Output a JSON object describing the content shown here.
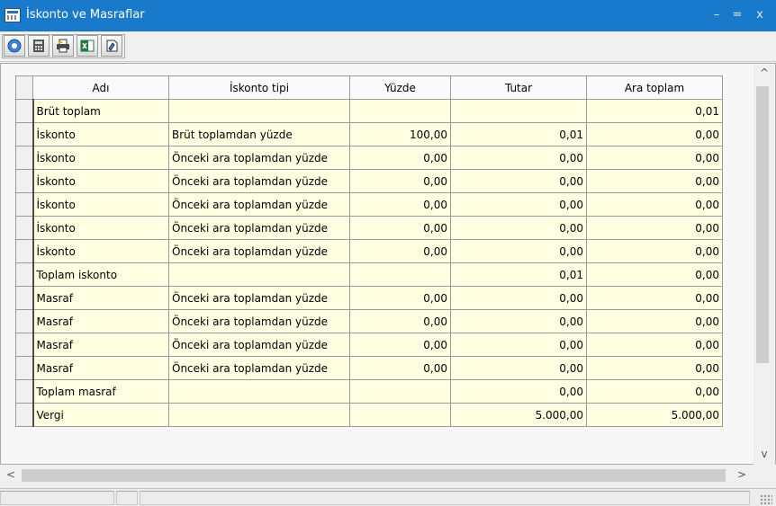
{
  "window": {
    "title": "İskonto ve Masraflar",
    "controls": {
      "minimize": "–",
      "maximize": "=",
      "close": "x"
    }
  },
  "toolbar": {
    "icons": [
      "help-icon",
      "calculator-icon",
      "print-icon",
      "excel-icon",
      "properties-icon"
    ]
  },
  "grid": {
    "columns": [
      "Adı",
      "İskonto tipi",
      "Yüzde",
      "Tutar",
      "Ara toplam"
    ],
    "rows": [
      {
        "name": "Brüt toplam",
        "type": "",
        "percent": "",
        "amount": "",
        "subtotal": "0,01"
      },
      {
        "name": "İskonto",
        "type": "Brüt toplamdan yüzde",
        "percent": "100,00",
        "amount": "0,01",
        "subtotal": "0,00"
      },
      {
        "name": "İskonto",
        "type": "Önceki ara toplamdan yüzde",
        "percent": "0,00",
        "amount": "0,00",
        "subtotal": "0,00"
      },
      {
        "name": "İskonto",
        "type": "Önceki ara toplamdan yüzde",
        "percent": "0,00",
        "amount": "0,00",
        "subtotal": "0,00"
      },
      {
        "name": "İskonto",
        "type": "Önceki ara toplamdan yüzde",
        "percent": "0,00",
        "amount": "0,00",
        "subtotal": "0,00"
      },
      {
        "name": "İskonto",
        "type": "Önceki ara toplamdan yüzde",
        "percent": "0,00",
        "amount": "0,00",
        "subtotal": "0,00"
      },
      {
        "name": "İskonto",
        "type": "Önceki ara toplamdan yüzde",
        "percent": "0,00",
        "amount": "0,00",
        "subtotal": "0,00"
      },
      {
        "name": "Toplam iskonto",
        "type": "",
        "percent": "",
        "amount": "0,01",
        "subtotal": "0,00"
      },
      {
        "name": "Masraf",
        "type": "Önceki ara toplamdan yüzde",
        "percent": "0,00",
        "amount": "0,00",
        "subtotal": "0,00"
      },
      {
        "name": "Masraf",
        "type": "Önceki ara toplamdan yüzde",
        "percent": "0,00",
        "amount": "0,00",
        "subtotal": "0,00"
      },
      {
        "name": "Masraf",
        "type": "Önceki ara toplamdan yüzde",
        "percent": "0,00",
        "amount": "0,00",
        "subtotal": "0,00"
      },
      {
        "name": "Masraf",
        "type": "Önceki ara toplamdan yüzde",
        "percent": "0,00",
        "amount": "0,00",
        "subtotal": "0,00"
      },
      {
        "name": "Toplam masraf",
        "type": "",
        "percent": "",
        "amount": "0,00",
        "subtotal": "0,00"
      },
      {
        "name": "Vergi",
        "type": "",
        "percent": "",
        "amount": "5.000,00",
        "subtotal": "5.000,00"
      }
    ]
  },
  "scrollbars": {
    "up": "^",
    "down": "v",
    "left": "<",
    "right": ">"
  }
}
